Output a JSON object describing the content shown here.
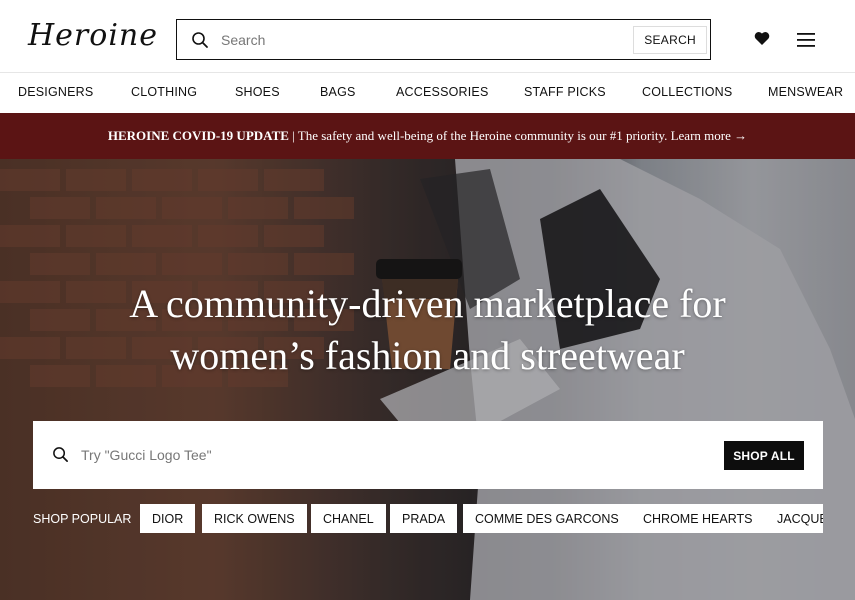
{
  "header": {
    "logo_text": "Heroine",
    "search_placeholder": "Search",
    "search_button": "SEARCH"
  },
  "nav": {
    "items": [
      "DESIGNERS",
      "CLOTHING",
      "SHOES",
      "BAGS",
      "ACCESSORIES",
      "STAFF PICKS",
      "COLLECTIONS",
      "MENSWEAR"
    ]
  },
  "banner": {
    "bold": "HEROINE COVID-19 UPDATE",
    "text": " | The safety and well-being of the Heroine community is our #1 priority. Learn more →"
  },
  "hero": {
    "title_line1": "A community-driven marketplace for",
    "title_line2": "women’s fashion and streetwear",
    "search_placeholder": "Try \"Gucci Logo Tee\"",
    "shop_all": "SHOP ALL",
    "shop_popular": "SHOP POPULAR",
    "chips": [
      "DIOR",
      "RICK OWENS",
      "CHANEL",
      "PRADA",
      "COMME DES GARCONS",
      "CHROME HEARTS",
      "JACQUEMUS"
    ]
  },
  "colors": {
    "banner": "#5b1414",
    "shop_all_button": "#0d0d0d"
  }
}
